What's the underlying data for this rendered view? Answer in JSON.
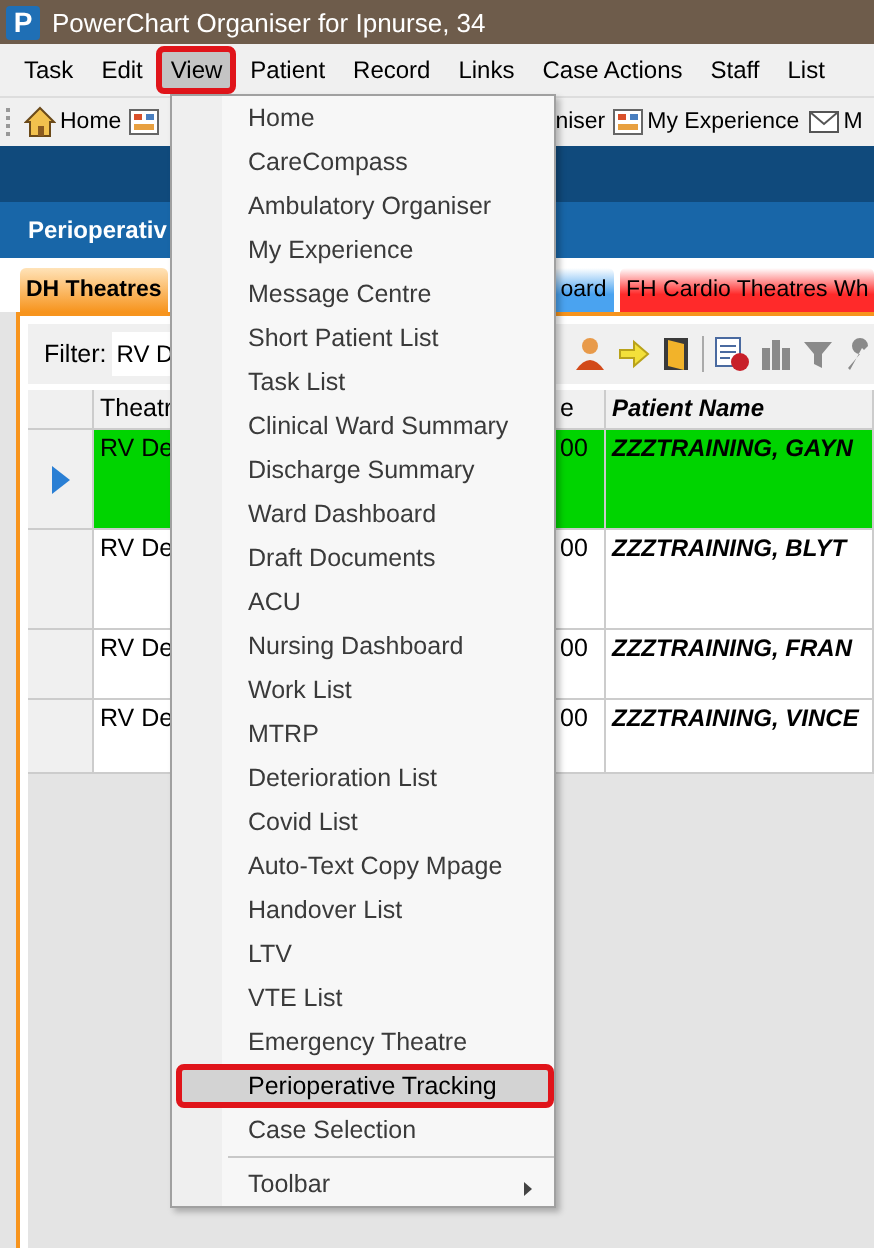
{
  "window": {
    "icon_text": "P",
    "title": "PowerChart Organiser for Ipnurse, 34"
  },
  "menu_bar": [
    {
      "label": "Task",
      "selected": false,
      "annotated": false
    },
    {
      "label": "Edit",
      "selected": false,
      "annotated": false
    },
    {
      "label": "View",
      "selected": true,
      "annotated": true
    },
    {
      "label": "Patient",
      "selected": false,
      "annotated": false
    },
    {
      "label": "Record",
      "selected": false,
      "annotated": false
    },
    {
      "label": "Links",
      "selected": false,
      "annotated": false
    },
    {
      "label": "Case Actions",
      "selected": false,
      "annotated": false
    },
    {
      "label": "Staff",
      "selected": false,
      "annotated": false
    },
    {
      "label": "List",
      "selected": false,
      "annotated": false
    }
  ],
  "toolbar": [
    {
      "kind": "house",
      "label": "Home"
    },
    {
      "kind": "chart"
    },
    {
      "kind": "text",
      "label": "niser"
    },
    {
      "kind": "chart",
      "label": "My Experience"
    },
    {
      "kind": "envelope",
      "label": "M"
    }
  ],
  "section": {
    "title": "Perioperativ"
  },
  "tabs": [
    {
      "label": "DH Theatres",
      "selected": true,
      "color": "#f7941d"
    },
    {
      "label": "oard",
      "selected": false,
      "color": "#4aa3f0"
    },
    {
      "label": "FH Cardio Theatres Wh",
      "selected": false,
      "color": "#ff2a2a"
    }
  ],
  "filter": {
    "label": "Filter:",
    "value": "RV D"
  },
  "table": {
    "columns": [
      "Theatr",
      "e",
      "Patient Name"
    ],
    "rows": [
      {
        "selected": true,
        "color": "#00d400",
        "cells": [
          "RV De",
          "00",
          "ZZZTRAINING, GAYN"
        ]
      },
      {
        "selected": false,
        "color": "#ffffff",
        "cells": [
          "RV De",
          "00",
          "ZZZTRAINING, BLYT"
        ]
      },
      {
        "selected": false,
        "color": "#ffffff",
        "cells": [
          "RV De",
          "00",
          "ZZZTRAINING, FRAN"
        ]
      },
      {
        "selected": false,
        "color": "#ffffff",
        "cells": [
          "RV De",
          "00",
          "ZZZTRAINING, VINCE"
        ]
      }
    ]
  },
  "view_menu": {
    "items": [
      {
        "kind": "item",
        "label": "Home",
        "selected": false,
        "annotated": false
      },
      {
        "kind": "item",
        "label": "CareCompass",
        "selected": false,
        "annotated": false
      },
      {
        "kind": "item",
        "label": "Ambulatory Organiser",
        "selected": false,
        "annotated": false
      },
      {
        "kind": "item",
        "label": "My Experience",
        "selected": false,
        "annotated": false
      },
      {
        "kind": "item",
        "label": "Message Centre",
        "selected": false,
        "annotated": false
      },
      {
        "kind": "item",
        "label": "Short Patient List",
        "selected": false,
        "annotated": false
      },
      {
        "kind": "item",
        "label": "Task List",
        "selected": false,
        "annotated": false
      },
      {
        "kind": "item",
        "label": "Clinical Ward Summary",
        "selected": false,
        "annotated": false
      },
      {
        "kind": "item",
        "label": "Discharge Summary",
        "selected": false,
        "annotated": false
      },
      {
        "kind": "item",
        "label": "Ward Dashboard",
        "selected": false,
        "annotated": false
      },
      {
        "kind": "item",
        "label": "Draft Documents",
        "selected": false,
        "annotated": false
      },
      {
        "kind": "item",
        "label": "ACU",
        "selected": false,
        "annotated": false
      },
      {
        "kind": "item",
        "label": "Nursing Dashboard",
        "selected": false,
        "annotated": false
      },
      {
        "kind": "item",
        "label": "Work List",
        "selected": false,
        "annotated": false
      },
      {
        "kind": "item",
        "label": "MTRP",
        "selected": false,
        "annotated": false
      },
      {
        "kind": "item",
        "label": "Deterioration List",
        "selected": false,
        "annotated": false
      },
      {
        "kind": "item",
        "label": "Covid List",
        "selected": false,
        "annotated": false
      },
      {
        "kind": "item",
        "label": "Auto-Text Copy Mpage",
        "selected": false,
        "annotated": false
      },
      {
        "kind": "item",
        "label": "Handover List",
        "selected": false,
        "annotated": false
      },
      {
        "kind": "item",
        "label": "LTV",
        "selected": false,
        "annotated": false
      },
      {
        "kind": "item",
        "label": "VTE List",
        "selected": false,
        "annotated": false
      },
      {
        "kind": "item",
        "label": "Emergency Theatre",
        "selected": false,
        "annotated": false
      },
      {
        "kind": "item",
        "label": "Perioperative Tracking",
        "selected": true,
        "annotated": true
      },
      {
        "kind": "item",
        "label": "Case Selection",
        "selected": false,
        "annotated": false
      },
      {
        "kind": "separator"
      },
      {
        "kind": "submenu",
        "label": "Toolbar",
        "selected": false,
        "annotated": false
      }
    ]
  }
}
